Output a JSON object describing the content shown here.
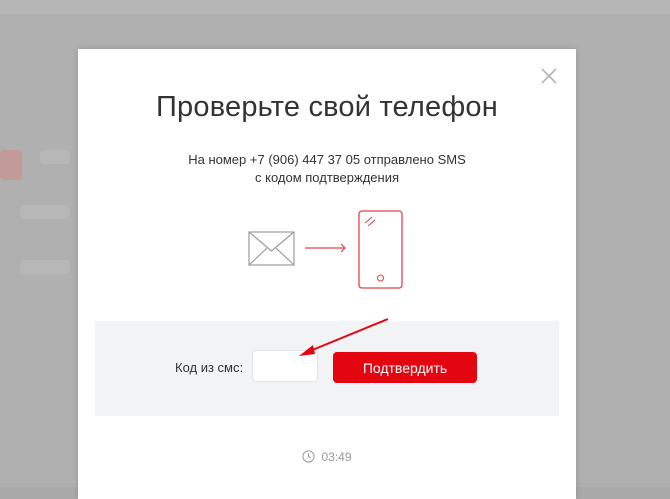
{
  "modal": {
    "title": "Проверьте свой телефон",
    "subtitle_line1": "На номер +7 (906) 447 37 05 отправлено SMS",
    "subtitle_line2": "с кодом подтверждения",
    "close_icon": "close-icon"
  },
  "form": {
    "code_label": "Код из смс:",
    "code_value": "",
    "confirm_label": "Подтвердить"
  },
  "timer": {
    "value": "03:49",
    "icon": "clock-icon"
  },
  "colors": {
    "accent": "#e30611",
    "illustration_red": "#e8424a",
    "panel_bg": "#f2f3f5"
  }
}
